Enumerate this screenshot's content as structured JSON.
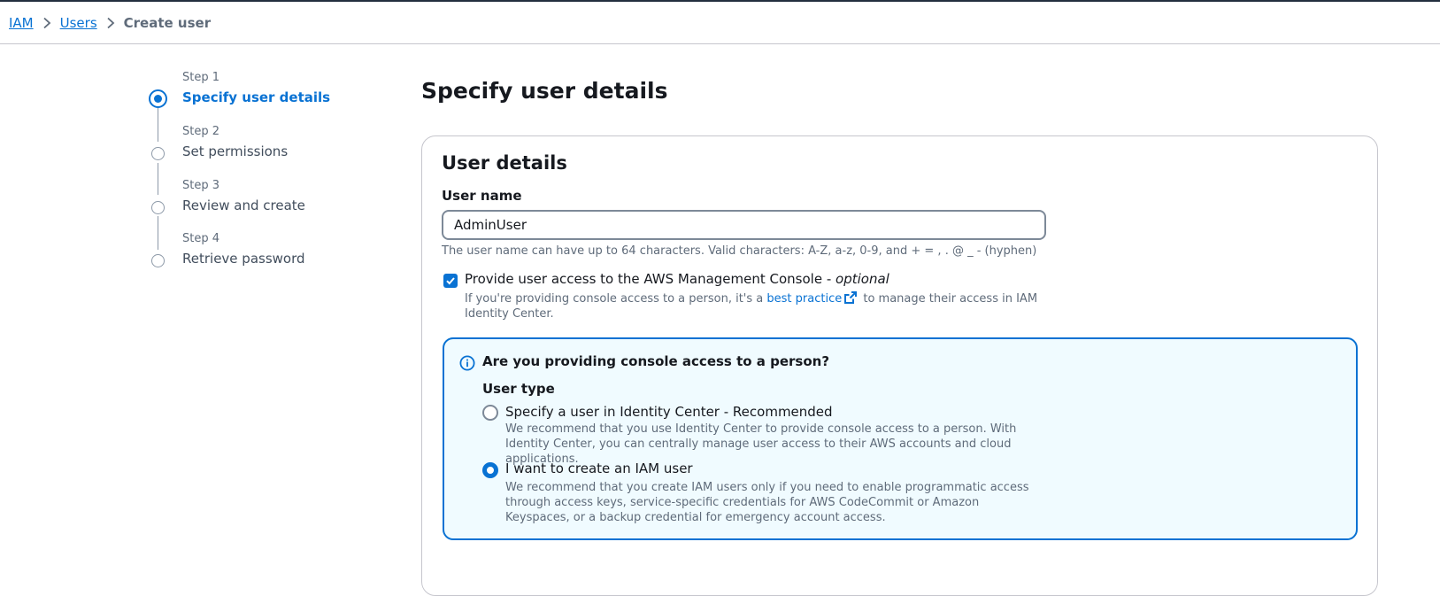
{
  "breadcrumb": {
    "items": [
      "IAM",
      "Users"
    ],
    "current": "Create user"
  },
  "steps": [
    {
      "number": "Step 1",
      "title": "Specify user details",
      "state": "active"
    },
    {
      "number": "Step 2",
      "title": "Set permissions",
      "state": "inactive"
    },
    {
      "number": "Step 3",
      "title": "Review and create",
      "state": "inactive"
    },
    {
      "number": "Step 4",
      "title": "Retrieve password",
      "state": "inactive"
    }
  ],
  "page_title": "Specify user details",
  "user_details": {
    "heading": "User details",
    "username_label": "User name",
    "username_value": "AdminUser",
    "username_constraint": "The user name can have up to 64 characters. Valid characters: A-Z, a-z, 0-9, and + = , . @ _ - (hyphen)",
    "console_access": {
      "label": "Provide user access to the AWS Management Console - ",
      "optional": "optional",
      "checked": true,
      "desc_before": "If you're providing console access to a person, it's a ",
      "desc_link": "best practice",
      "desc_after": " to manage their access in IAM Identity Center."
    }
  },
  "info_box": {
    "icon": "info-icon",
    "title": "Are you providing console access to a person?",
    "user_type_label": "User type",
    "options": [
      {
        "label": "Specify a user in Identity Center - Recommended",
        "desc": "We recommend that you use Identity Center to provide console access to a person. With Identity Center, you can centrally manage user access to their AWS accounts and cloud applications.",
        "selected": false
      },
      {
        "label": "I want to create an IAM user",
        "desc": "We recommend that you create IAM users only if you need to enable programmatic access through access keys, service-specific credentials for AWS CodeCommit or Amazon Keyspaces, or a backup credential for emergency account access.",
        "selected": true
      }
    ]
  },
  "colors": {
    "accent": "#0972d3",
    "info_bg": "#f0fbff",
    "text": "#16191f",
    "muted": "#5f6b7a"
  }
}
